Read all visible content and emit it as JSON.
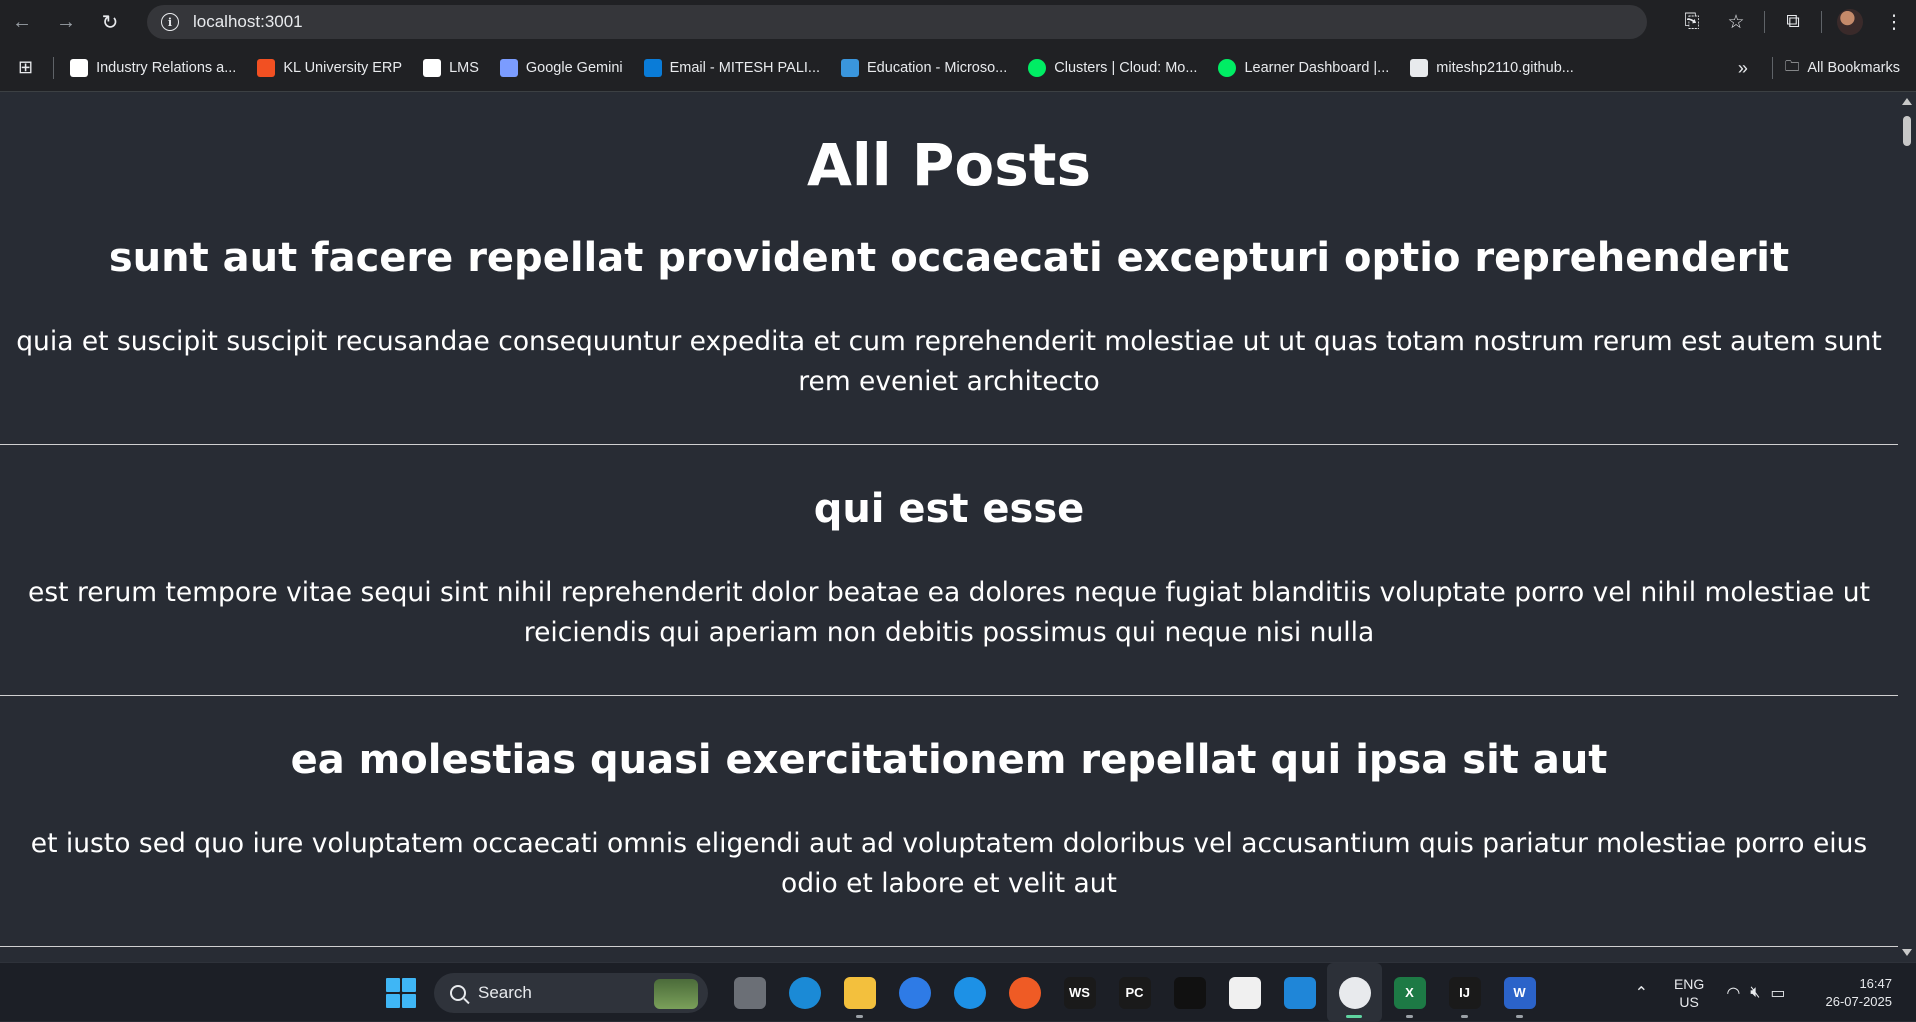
{
  "browser": {
    "url": "localhost:3001",
    "bookmarks": [
      {
        "label": "Industry Relations a...",
        "icon": "kl-seal-icon",
        "color": "#ffffff"
      },
      {
        "label": "KL University ERP",
        "icon": "windows-tiles-icon",
        "color": "#f25022"
      },
      {
        "label": "LMS",
        "icon": "moodle-icon",
        "color": "#ffffff"
      },
      {
        "label": "Google Gemini",
        "icon": "gemini-spark-icon",
        "color": "#7b9cff"
      },
      {
        "label": "Email - MITESH PALI...",
        "icon": "outlook-icon",
        "color": "#0a7cd8"
      },
      {
        "label": "Education - Microso...",
        "icon": "azure-icon",
        "color": "#3a96dd"
      },
      {
        "label": "Clusters | Cloud: Mo...",
        "icon": "mongodb-leaf-icon",
        "color": "#00ed64"
      },
      {
        "label": "Learner Dashboard |...",
        "icon": "mongodb-leaf-icon",
        "color": "#00ed64"
      },
      {
        "label": "miteshp2110.github...",
        "icon": "code-icon",
        "color": "#e8eaed"
      }
    ],
    "all_bookmarks_label": "All Bookmarks"
  },
  "page": {
    "title": "All Posts",
    "posts": [
      {
        "title": "sunt aut facere repellat provident occaecati excepturi optio reprehenderit",
        "body": "quia et suscipit suscipit recusandae consequuntur expedita et cum reprehenderit molestiae ut ut quas totam nostrum rerum est autem sunt rem eveniet architecto"
      },
      {
        "title": "qui est esse",
        "body": "est rerum tempore vitae sequi sint nihil reprehenderit dolor beatae ea dolores neque fugiat blanditiis voluptate porro vel nihil molestiae ut reiciendis qui aperiam non debitis possimus qui neque nisi nulla"
      },
      {
        "title": "ea molestias quasi exercitationem repellat qui ipsa sit aut",
        "body": "et iusto sed quo iure voluptatem occaecati omnis eligendi aut ad voluptatem doloribus vel accusantium quis pariatur molestiae porro eius odio et labore et velit aut"
      }
    ]
  },
  "taskbar": {
    "search_label": "Search",
    "apps": [
      {
        "name": "task-view",
        "label": "",
        "color": "#6b6f76"
      },
      {
        "name": "edge",
        "label": "",
        "color": "#1b8ad6"
      },
      {
        "name": "file-explorer",
        "label": "",
        "color": "#f3c03d"
      },
      {
        "name": "app-store",
        "label": "",
        "color": "#2e7be6"
      },
      {
        "name": "docker",
        "label": "",
        "color": "#1d91e6"
      },
      {
        "name": "postman",
        "label": "",
        "color": "#ef5b25"
      },
      {
        "name": "webstorm",
        "label": "WS",
        "color": "#1a1a1a"
      },
      {
        "name": "pycharm",
        "label": "PC",
        "color": "#1a1a1a"
      },
      {
        "name": "terminal",
        "label": "",
        "color": "#111111"
      },
      {
        "name": "notion",
        "label": "",
        "color": "#f0f0f0"
      },
      {
        "name": "vscode",
        "label": "",
        "color": "#1f86d8"
      },
      {
        "name": "chrome",
        "label": "",
        "color": "#e8eaed"
      },
      {
        "name": "excel",
        "label": "X",
        "color": "#1d7a45"
      },
      {
        "name": "intellij",
        "label": "IJ",
        "color": "#1a1a1a"
      },
      {
        "name": "word",
        "label": "W",
        "color": "#2b63c9"
      }
    ],
    "language": {
      "line1": "ENG",
      "line2": "US"
    },
    "time": "16:47",
    "date": "26-07-2025"
  }
}
